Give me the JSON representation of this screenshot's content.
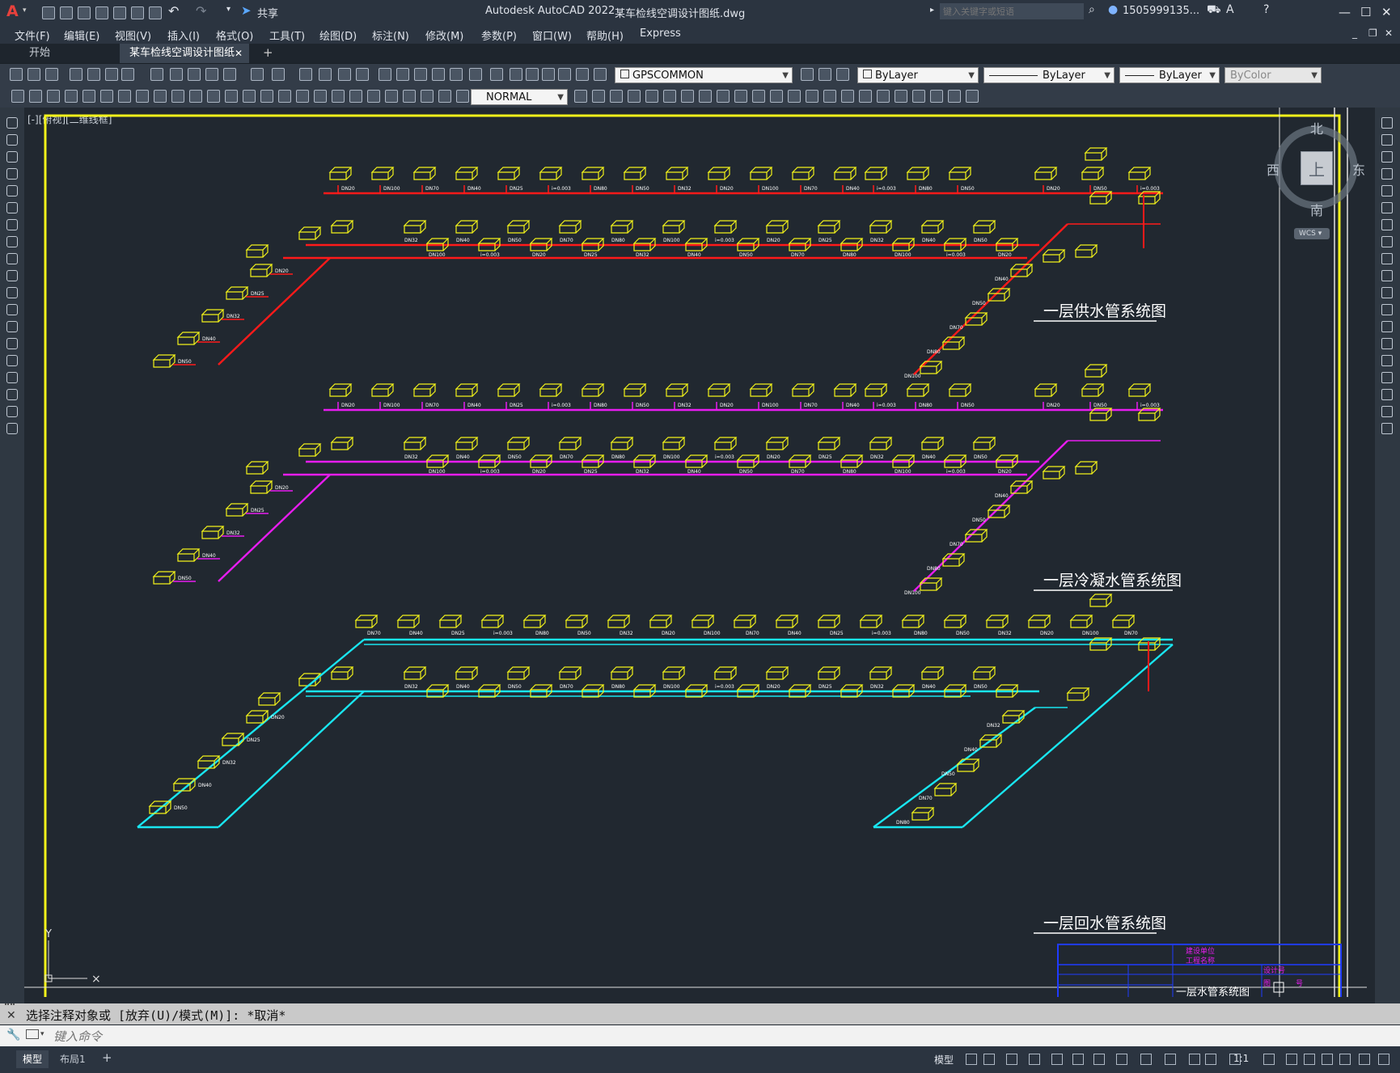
{
  "titlebar": {
    "logo": "A",
    "share_label": "共享",
    "app_title": "Autodesk AutoCAD 2022",
    "file_name": "某车检线空调设计图纸.dwg",
    "search_placeholder": "键入关键字或短语",
    "user": "1505999135...",
    "icon_names": [
      "new-icon",
      "open-icon",
      "save-icon",
      "saveas-icon",
      "plot-icon",
      "undo-icon",
      "redo-icon",
      "share-icon",
      "search-icon",
      "user-icon",
      "cart-icon",
      "help-icon"
    ]
  },
  "menu": [
    "文件(F)",
    "编辑(E)",
    "视图(V)",
    "插入(I)",
    "格式(O)",
    "工具(T)",
    "绘图(D)",
    "标注(N)",
    "修改(M)",
    "参数(P)",
    "窗口(W)",
    "帮助(H)",
    "Express"
  ],
  "tabs": [
    {
      "label": "开始",
      "active": false
    },
    {
      "label": "某车检线空调设计图纸*",
      "active": true
    }
  ],
  "toolbar": {
    "layer": "GPSCOMMON",
    "color": "ByLayer",
    "linetype": "ByLayer",
    "lineweight": "ByLayer",
    "plotstyle": "ByColor",
    "textstyle": "NORMAL"
  },
  "viewport": {
    "label": "[-][俯视][二维线框]",
    "compass": {
      "north": "北",
      "south": "南",
      "east": "东",
      "west": "西",
      "top": "上",
      "wcs": "WCS"
    },
    "ucs_y": "Y",
    "diagram_titles": [
      "一层供水管系统图",
      "一层冷凝水管系统图",
      "一层回水管系统图"
    ],
    "titleblock_title": "一层水管系统图",
    "titleblock_small": [
      "建设单位",
      "工程名称",
      "设计号",
      "图",
      "号"
    ],
    "pipe_colors": {
      "supply": "#ff1a1a",
      "condensate": "#e81cf0",
      "return": "#19e6f0",
      "unit": "#f2f21a",
      "frame": "#f2f21a",
      "titleblock": "#1f3bff"
    },
    "pipe_labels": [
      "DN20",
      "DN25",
      "DN32",
      "DN40",
      "DN50",
      "DN70",
      "DN80",
      "DN100",
      "i=0.003"
    ]
  },
  "command": {
    "history": "选择注释对象或 [放弃(U)/模式(M)]: *取消*",
    "placeholder": "键入命令"
  },
  "status": {
    "layout_tabs": [
      "模型",
      "布局1"
    ],
    "model_label": "模型",
    "scale": "1:1"
  }
}
